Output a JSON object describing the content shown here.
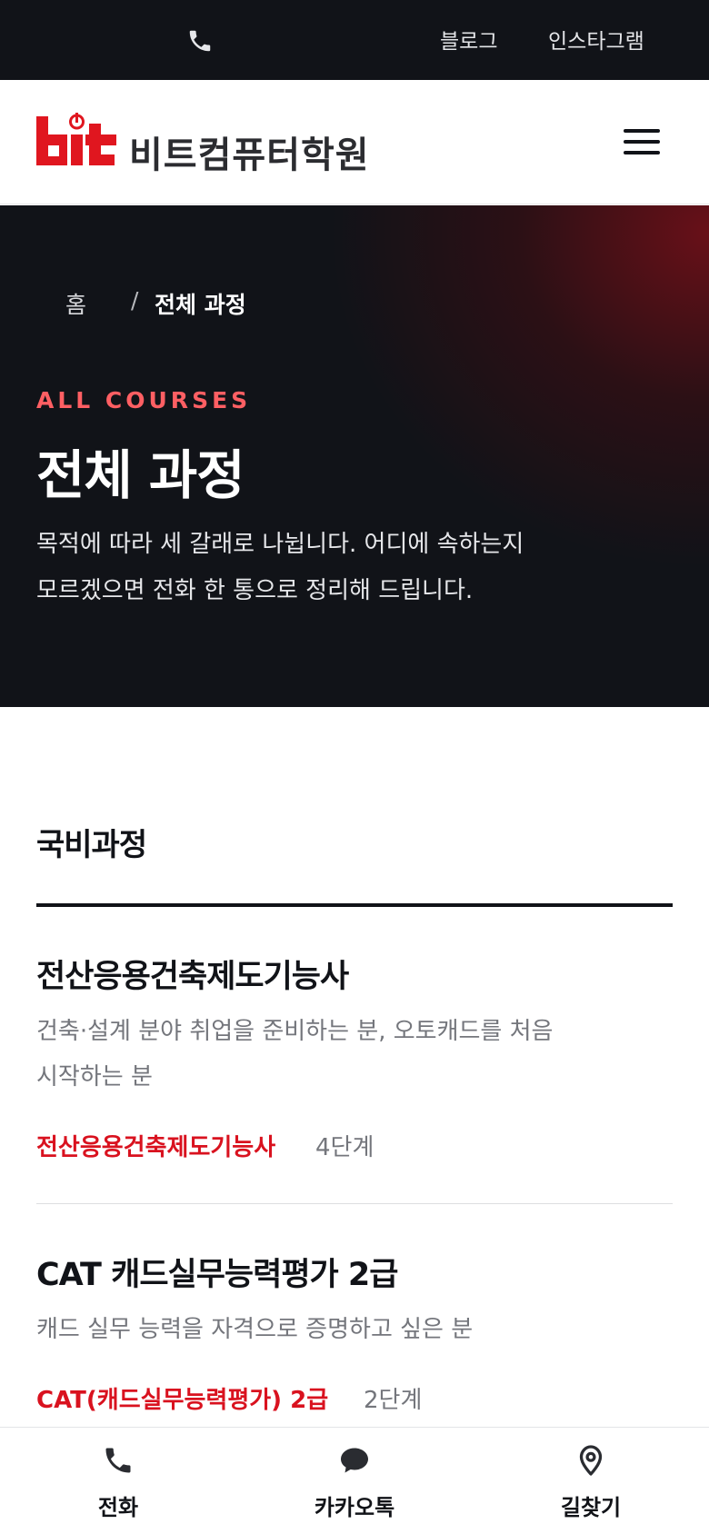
{
  "topbar": {
    "phone_icon": "phone-icon",
    "blog_label": "블로그",
    "instagram_label": "인스타그램"
  },
  "header": {
    "logo_mark": "bit",
    "logo_text": "비트컴퓨터학원",
    "menu_icon": "hamburger-icon",
    "brand_color": "#e0161f"
  },
  "hero": {
    "breadcrumb": {
      "home": "홈",
      "separator": "/",
      "current": "전체 과정"
    },
    "eyebrow": "ALL COURSES",
    "title": "전체 과정",
    "desc_line1": "목적에 따라 세 갈래로 나뉩니다. 어디에 속하는지",
    "desc_line2": "모르겠으면 전화 한 통으로 정리해 드립니다."
  },
  "section": {
    "title": "국비과정",
    "courses": [
      {
        "title": "전산응용건축제도기능사",
        "desc_line1": "건축·설계 분야 취업을 준비하는 분, 오토캐드를 처음",
        "desc_line2": "시작하는 분",
        "tag": "전산응용건축제도기능사",
        "steps": "4단계"
      },
      {
        "title": "CAT 캐드실무능력평가 2급",
        "desc_line1": "캐드 실무 능력을 자격으로 증명하고 싶은 분",
        "tag": "CAT(캐드실무능력평가) 2급",
        "steps": "2단계"
      }
    ]
  },
  "bottom_nav": {
    "call": {
      "label": "전화",
      "icon": "phone-icon"
    },
    "kakao": {
      "label": "카카오톡",
      "icon": "chat-bubble-icon"
    },
    "map": {
      "label": "길찾기",
      "icon": "map-pin-icon"
    }
  },
  "colors": {
    "accent_red": "#d9121f",
    "eyebrow_red": "#ff5f63",
    "dark_bg": "#111318"
  }
}
